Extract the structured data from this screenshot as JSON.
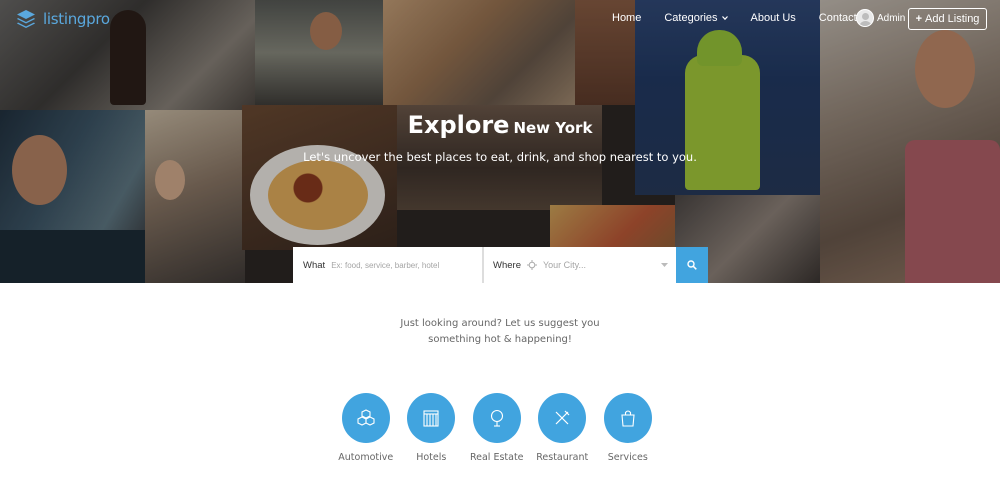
{
  "brand": {
    "name": "listingpro",
    "color": "#5aa8de"
  },
  "nav": {
    "items": [
      {
        "label": "Home"
      },
      {
        "label": "Categories",
        "has_dropdown": true
      },
      {
        "label": "About Us"
      },
      {
        "label": "Contact"
      }
    ],
    "user_name": "Admin",
    "add_listing_label": "Add Listing"
  },
  "hero": {
    "headline": "Explore",
    "city": "New York",
    "subheadline": "Let's uncover the best places to eat, drink, and shop nearest to you."
  },
  "search": {
    "what_label": "What",
    "what_placeholder": "Ex: food, service, barber, hotel",
    "where_label": "Where",
    "where_placeholder": "Your City...",
    "button_color": "#41a4df"
  },
  "suggest": {
    "line1": "Just looking around? Let us suggest you",
    "line2": "something hot & happening!"
  },
  "categories": [
    {
      "label": "Automotive",
      "icon": "cubes-icon"
    },
    {
      "label": "Hotels",
      "icon": "hotel-building-icon"
    },
    {
      "label": "Real Estate",
      "icon": "map-pin-icon"
    },
    {
      "label": "Restaurant",
      "icon": "fork-knife-icon"
    },
    {
      "label": "Services",
      "icon": "shopping-bag-icon"
    }
  ],
  "accent_color": "#41a4df"
}
